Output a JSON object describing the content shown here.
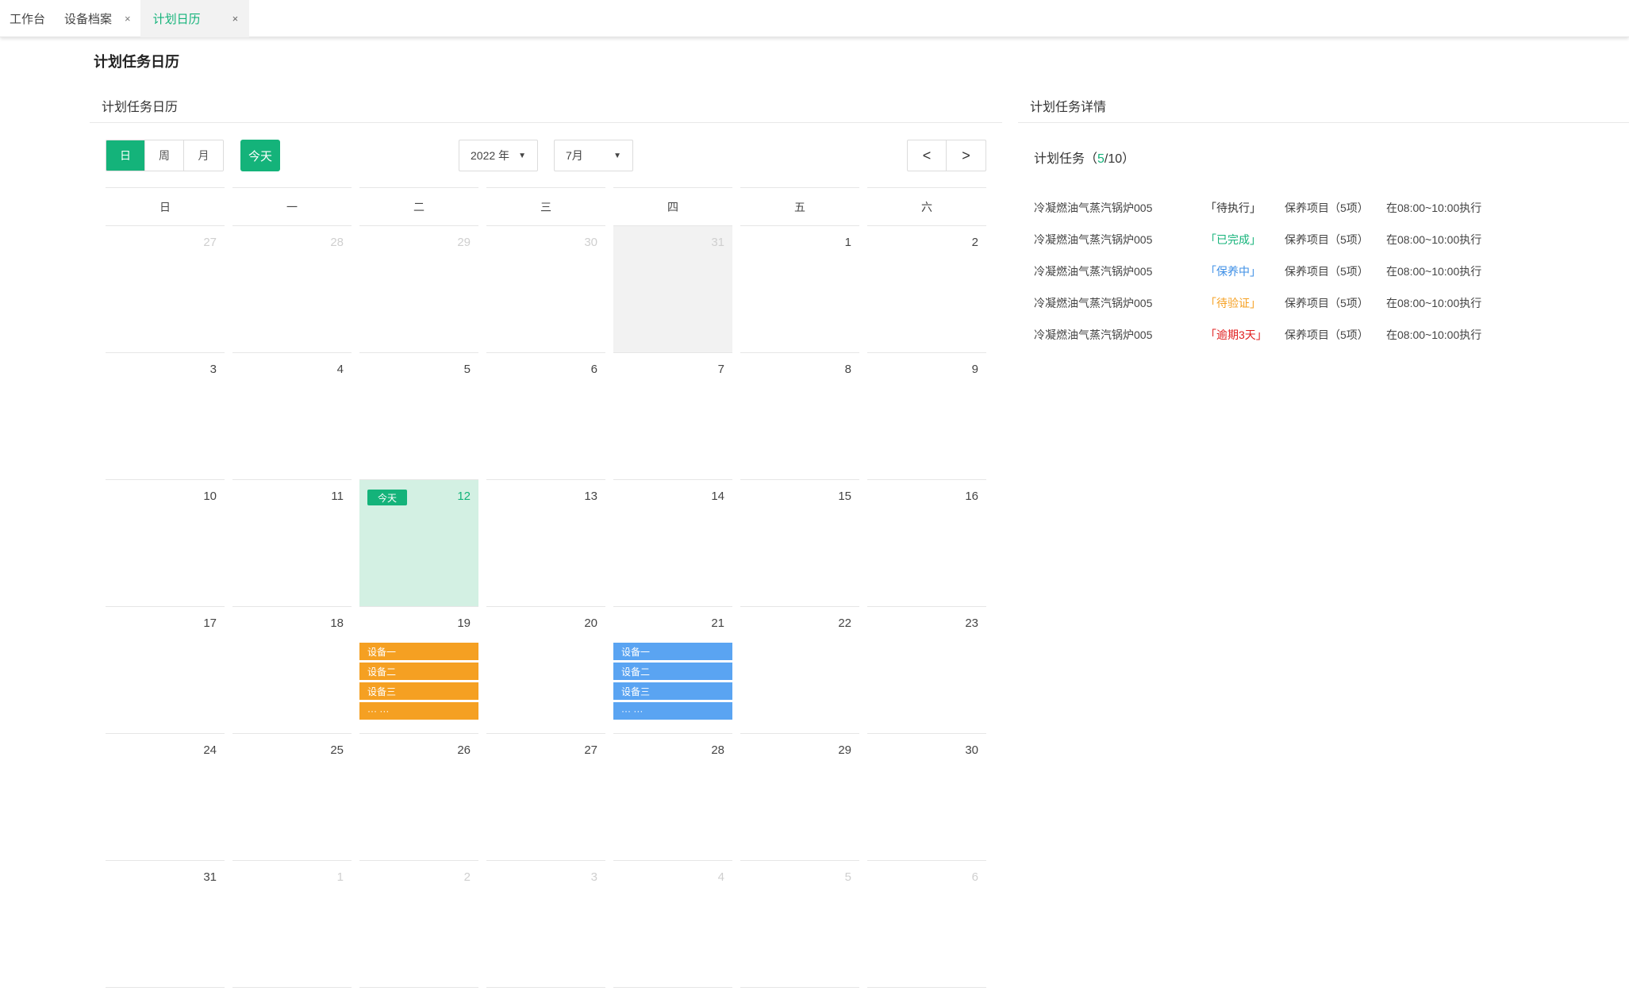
{
  "tabs": [
    {
      "label": "工作台",
      "closable": false
    },
    {
      "label": "设备档案",
      "closable": true
    },
    {
      "label": "计划日历",
      "closable": true,
      "active": true
    }
  ],
  "close_glyph": "×",
  "page_title": "计划任务日历",
  "left_panel": {
    "title": "计划任务日历",
    "view_modes": [
      "日",
      "周",
      "月"
    ],
    "active_view": "日",
    "today_button": "今天",
    "year_select": "2022 年",
    "month_select": "7月",
    "prev_glyph": "<",
    "next_glyph": ">"
  },
  "calendar": {
    "weekdays": [
      "日",
      "一",
      "二",
      "三",
      "四",
      "五",
      "六"
    ],
    "today_tag": "今天",
    "weeks": [
      [
        {
          "n": "27",
          "other": true
        },
        {
          "n": "28",
          "other": true
        },
        {
          "n": "29",
          "other": true
        },
        {
          "n": "30",
          "other": true
        },
        {
          "n": "31",
          "other": true,
          "gray": true
        },
        {
          "n": "1"
        },
        {
          "n": "2"
        }
      ],
      [
        {
          "n": "3"
        },
        {
          "n": "4"
        },
        {
          "n": "5"
        },
        {
          "n": "6"
        },
        {
          "n": "7"
        },
        {
          "n": "8"
        },
        {
          "n": "9"
        }
      ],
      [
        {
          "n": "10"
        },
        {
          "n": "11"
        },
        {
          "n": "12",
          "today": true
        },
        {
          "n": "13"
        },
        {
          "n": "14"
        },
        {
          "n": "15"
        },
        {
          "n": "16"
        }
      ],
      [
        {
          "n": "17"
        },
        {
          "n": "18"
        },
        {
          "n": "19",
          "events": {
            "color": "orange",
            "items": [
              "设备一",
              "设备二",
              "设备三",
              "··· ···"
            ]
          }
        },
        {
          "n": "20"
        },
        {
          "n": "21",
          "events": {
            "color": "blue",
            "items": [
              "设备一",
              "设备二",
              "设备三",
              "··· ···"
            ]
          }
        },
        {
          "n": "22"
        },
        {
          "n": "23"
        }
      ],
      [
        {
          "n": "24"
        },
        {
          "n": "25"
        },
        {
          "n": "26"
        },
        {
          "n": "27"
        },
        {
          "n": "28"
        },
        {
          "n": "29"
        },
        {
          "n": "30"
        }
      ],
      [
        {
          "n": "31"
        },
        {
          "n": "1",
          "other": true
        },
        {
          "n": "2",
          "other": true
        },
        {
          "n": "3",
          "other": true
        },
        {
          "n": "4",
          "other": true
        },
        {
          "n": "5",
          "other": true
        },
        {
          "n": "6",
          "other": true
        }
      ]
    ]
  },
  "right_panel": {
    "title": "计划任务详情",
    "summary_label": "计划任务（",
    "done_count": "5",
    "total_sep": "/10）",
    "tasks": [
      {
        "name": "冷凝燃油气蒸汽锅炉005",
        "status": "「待执行」",
        "status_class": "st-wait",
        "item": "保养项目（5项）",
        "time": "在08:00~10:00执行"
      },
      {
        "name": "冷凝燃油气蒸汽锅炉005",
        "status": "「已完成」",
        "status_class": "st-done",
        "item": "保养项目（5项）",
        "time": "在08:00~10:00执行"
      },
      {
        "name": "冷凝燃油气蒸汽锅炉005",
        "status": "「保养中」",
        "status_class": "st-doing",
        "item": "保养项目（5项）",
        "time": "在08:00~10:00执行"
      },
      {
        "name": "冷凝燃油气蒸汽锅炉005",
        "status": "「待验证」",
        "status_class": "st-verify",
        "item": "保养项目（5项）",
        "time": "在08:00~10:00执行"
      },
      {
        "name": "冷凝燃油气蒸汽锅炉005",
        "status": "「逾期3天」",
        "status_class": "st-overdue",
        "item": "保养项目（5项）",
        "time": "在08:00~10:00执行"
      }
    ]
  }
}
